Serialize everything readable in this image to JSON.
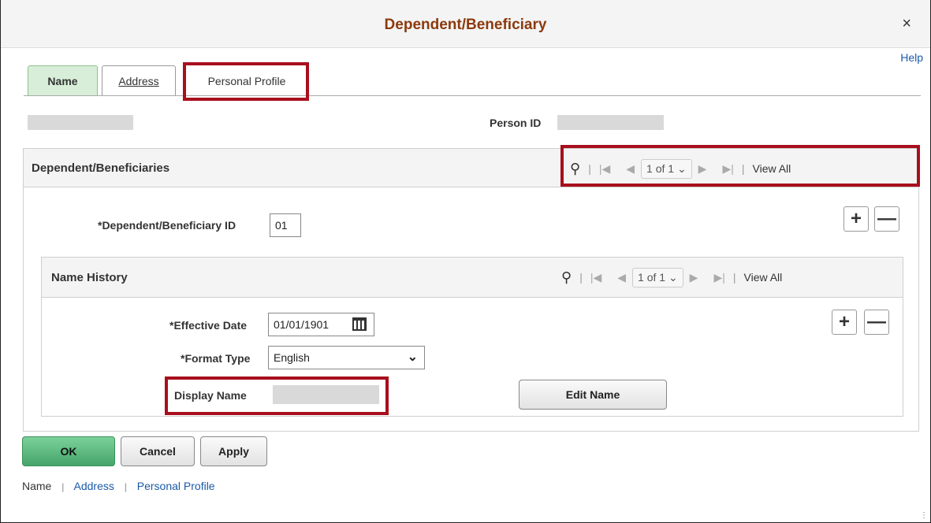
{
  "dialog": {
    "title": "Dependent/Beneficiary",
    "close_label": "×",
    "help_label": "Help"
  },
  "tabs": [
    {
      "label": "Name",
      "active": true
    },
    {
      "label": "Address",
      "active": false
    },
    {
      "label": "Personal Profile",
      "active": false
    }
  ],
  "header": {
    "person_id_label": "Person ID"
  },
  "dependents": {
    "title": "Dependent/Beneficiaries",
    "pager": "1 of 1",
    "view_all": "View All",
    "id_label": "*Dependent/Beneficiary ID",
    "id_value": "01"
  },
  "name_history": {
    "title": "Name History",
    "pager": "1 of 1",
    "view_all": "View All",
    "effective_date_label": "*Effective Date",
    "effective_date_value": "01/01/1901",
    "format_type_label": "*Format Type",
    "format_type_value": "English",
    "display_name_label": "Display Name",
    "edit_name_label": "Edit Name"
  },
  "buttons": {
    "ok": "OK",
    "cancel": "Cancel",
    "apply": "Apply"
  },
  "footer_nav": {
    "name": "Name",
    "address": "Address",
    "personal_profile": "Personal Profile"
  },
  "colors": {
    "title": "#8c3a0d",
    "highlight": "#a80f1d",
    "link": "#1a5aa8",
    "ok_button": "#45a56a",
    "active_tab": "#d8eed8"
  }
}
